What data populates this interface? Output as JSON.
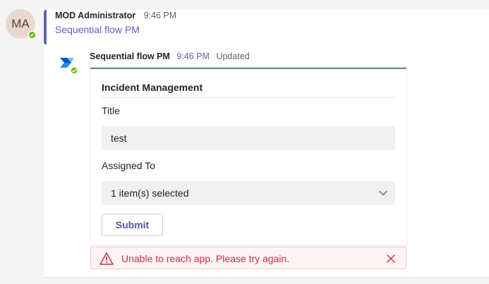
{
  "avatar": {
    "initials": "MA",
    "presence_color": "#6bb700"
  },
  "message": {
    "sender": "MOD Administrator",
    "time": "9:46 PM",
    "text": "Sequential flow PM"
  },
  "reply": {
    "sender": "Sequential flow PM",
    "time": "9:46 PM",
    "status": "Updated",
    "bot_icon": "power-automate-icon"
  },
  "card": {
    "title": "Incident Management",
    "title_label": "Title",
    "title_value": "test",
    "assigned_label": "Assigned To",
    "assigned_value": "1 item(s) selected",
    "submit_label": "Submit"
  },
  "error": {
    "text": "Unable to reach app. Please try again.",
    "icon": "warning-icon",
    "close_icon": "close-icon",
    "color": "#c4314b"
  },
  "colors": {
    "brand": "#6264a7",
    "card_accent": "#5c8a75",
    "link": "#5b5fc7"
  }
}
